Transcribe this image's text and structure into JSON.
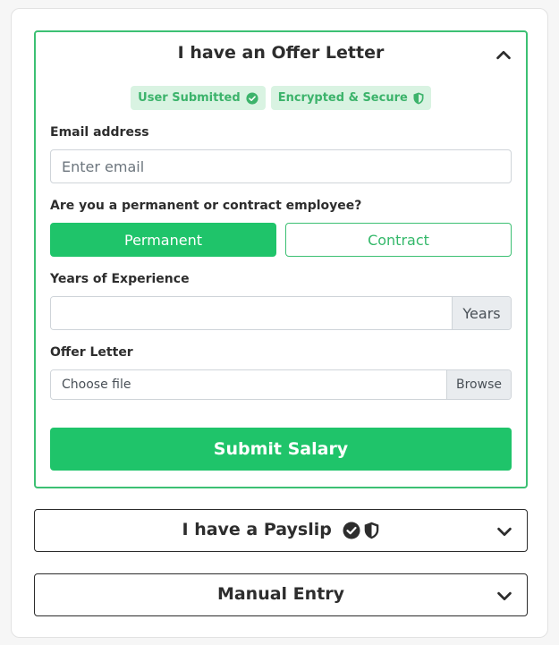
{
  "offer_panel": {
    "title": "I have an Offer Letter",
    "badges": [
      {
        "label": "User Submitted",
        "icon": "check-circle-icon"
      },
      {
        "label": "Encrypted & Secure",
        "icon": "shield-icon"
      }
    ],
    "email": {
      "label": "Email address",
      "placeholder": "Enter email",
      "value": ""
    },
    "employment": {
      "label": "Are you a permanent or contract employee?",
      "options": [
        "Permanent",
        "Contract"
      ],
      "selected": "Permanent"
    },
    "experience": {
      "label": "Years of Experience",
      "value": "",
      "suffix": "Years"
    },
    "offer_letter": {
      "label": "Offer Letter",
      "placeholder": "Choose file",
      "browse_label": "Browse"
    },
    "submit_label": "Submit Salary"
  },
  "payslip_panel": {
    "title": "I have a Payslip",
    "icons": [
      "check-circle-icon",
      "shield-icon"
    ]
  },
  "manual_panel": {
    "title": "Manual Entry"
  },
  "colors": {
    "accent": "#1fc46a",
    "accent_border": "#3cc073",
    "badge_bg": "#d9f3e2",
    "badge_text": "#3cb36b"
  }
}
